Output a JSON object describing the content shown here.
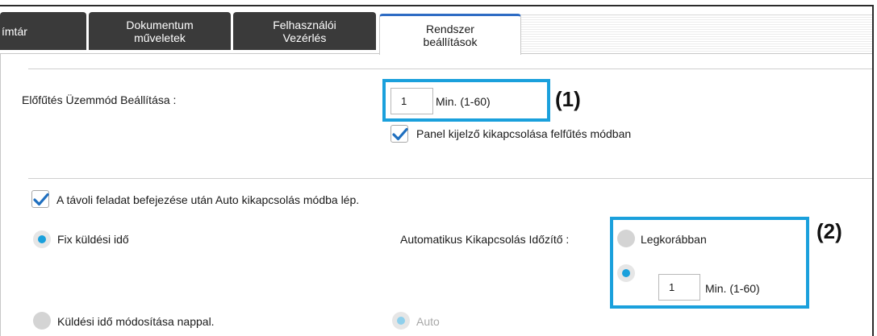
{
  "tabs": [
    {
      "label": "ímtár"
    },
    {
      "label": "Dokumentum\nműveletek"
    },
    {
      "label": "Felhasználói\nVezérlés"
    },
    {
      "label": "Rendszer\nbeállítások"
    }
  ],
  "preheat": {
    "label": "Előfűtés Üzemmód Beállítása :",
    "value": "1",
    "unit": "Min. (1-60)",
    "panel_off_label": "Panel kijelző kikapcsolása felfűtés módban",
    "panel_off_checked": true
  },
  "remote": {
    "label": "A távoli feladat befejezése után Auto kikapcsolás módba lép.",
    "checked": true
  },
  "send_time": {
    "fixed_label": "Fix küldési idő",
    "daytime_label": "Küldési idő módosítása nappal.",
    "auto_label": "Auto"
  },
  "auto_off_timer": {
    "label": "Automatikus Kikapcsolás Időzítő :",
    "earliest_label": "Legkorábban",
    "value": "1",
    "unit": "Min. (1-60)"
  },
  "callouts": {
    "one": "(1)",
    "two": "(2)"
  },
  "colors": {
    "highlight": "#1aa0dc",
    "tab_dark": "#3a3a3a",
    "active_tab_accent": "#2e6cc4",
    "check": "#1f6fbf"
  }
}
